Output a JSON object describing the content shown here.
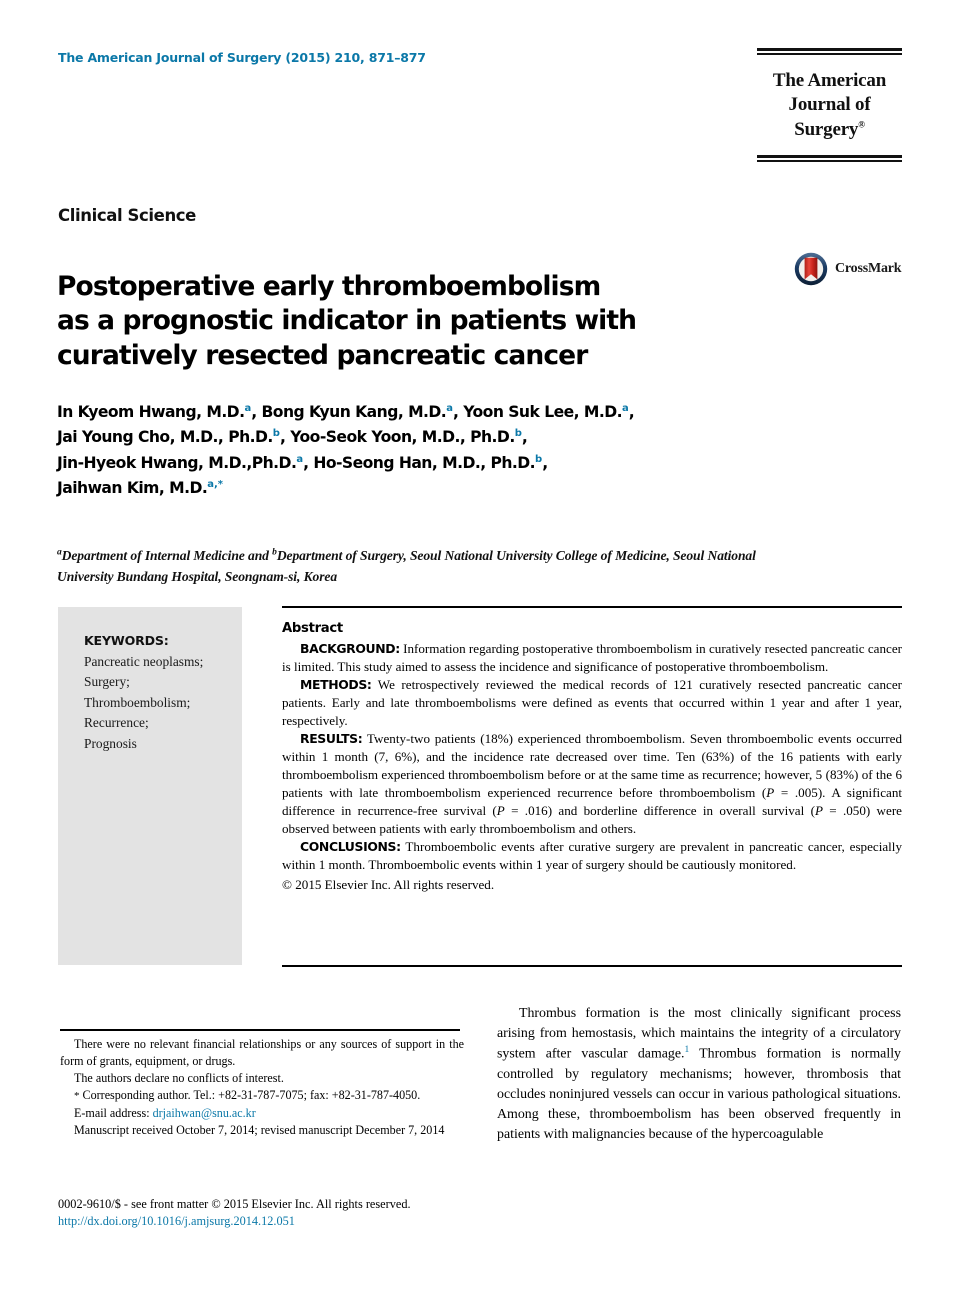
{
  "header": {
    "journal_citation": "The American Journal of Surgery (2015) 210, 871–877",
    "masthead_line1": "The American",
    "masthead_line2": "Journal of Surgery",
    "masthead_registered": "®",
    "accent_color": "#0b78a8"
  },
  "article": {
    "kicker": "Clinical Science",
    "title_line1": "Postoperative early thromboembolism",
    "title_line2": "as a prognostic indicator in patients with",
    "title_line3": "curatively resected pancreatic cancer",
    "crossmark_label": "CrossMark"
  },
  "authors": {
    "line1": "In Kyeom Hwang, M.D.",
    "line1_sup1": "a",
    "line1_b": ", Bong Kyun Kang, M.D.",
    "line1_sup2": "a",
    "line1_c": ", Yoon Suk Lee, M.D.",
    "line1_sup3": "a",
    "line1_d": ",",
    "line2": "Jai Young Cho, M.D., Ph.D.",
    "line2_sup1": "b",
    "line2_b": ", Yoo-Seok Yoon, M.D., Ph.D.",
    "line2_sup2": "b",
    "line2_c": ",",
    "line3": "Jin-Hyeok Hwang, M.D.,Ph.D.",
    "line3_sup1": "a",
    "line3_b": ", Ho-Seong Han, M.D., Ph.D.",
    "line3_sup2": "b",
    "line3_c": ",",
    "line4": "Jaihwan Kim, M.D.",
    "line4_sup1": "a",
    "line4_sup_sep": ",",
    "line4_sup2": "*"
  },
  "affiliations": {
    "sup_a": "a",
    "text_a": "Department of Internal Medicine and ",
    "sup_b": "b",
    "text_b": "Department of Surgery, Seoul National University College of Medicine, Seoul National University Bundang Hospital, Seongnam-si, Korea"
  },
  "keywords": {
    "heading": "KEYWORDS:",
    "items": [
      "Pancreatic neoplasms;",
      "Surgery;",
      "Thromboembolism;",
      "Recurrence;",
      "Prognosis"
    ],
    "background_color": "#e3e3e3"
  },
  "abstract": {
    "title": "Abstract",
    "background_label": "BACKGROUND:",
    "background_text": " Information regarding postoperative thromboembolism in curatively resected pancreatic cancer is limited. This study aimed to assess the incidence and significance of postoperative thromboembolism.",
    "methods_label": "METHODS:",
    "methods_text": "  We retrospectively reviewed the medical records of 121 curatively resected pancreatic cancer patients. Early and late thromboembolisms were defined as events that occurred within 1 year and after 1 year, respectively.",
    "results_label": "RESULTS:",
    "results_text_1": " Twenty-two patients (18%) experienced thromboembolism. Seven thromboembolic events occurred within 1 month (7, 6%), and the incidence rate decreased over time. Ten (63%) of the 16 patients with early thromboembolism experienced thromboembolism before or at the same time as recurrence; however, 5 (83%) of the 6 patients with late thromboembolism experienced recurrence before thromboembolism (",
    "results_p1": "P",
    "results_text_2": " = .005). A significant difference in recurrence-free survival (",
    "results_p2": "P",
    "results_text_3": " = .016) and borderline difference in overall survival (",
    "results_p3": "P",
    "results_text_4": " = .050) were observed between patients with early thromboembolism and others.",
    "conclusions_label": "CONCLUSIONS:",
    "conclusions_text": "  Thromboembolic events after curative surgery are prevalent in pancreatic cancer, especially within 1 month. Thromboembolic events within 1 year of surgery should be cautiously monitored.",
    "copyright": "© 2015 Elsevier Inc. All rights reserved."
  },
  "footnotes": {
    "funding": "There were no relevant financial relationships or any sources of support in the form of grants, equipment, or drugs.",
    "conflicts": "The authors declare no conflicts of interest.",
    "corresponding_marker": "*",
    "corresponding": " Corresponding author. Tel.: +82-31-787-7075; fax: +82-31-787-4050.",
    "email_label": "E-mail address: ",
    "email": "drjaihwan@snu.ac.kr",
    "manuscript_dates": "Manuscript received October 7, 2014; revised manuscript December 7, 2014"
  },
  "bottom": {
    "issn_line": "0002-9610/$ - see front matter © 2015 Elsevier Inc. All rights reserved.",
    "doi": "http://dx.doi.org/10.1016/j.amjsurg.2014.12.051"
  },
  "body": {
    "paragraph_1a": "Thrombus formation is the most clinically significant process arising from hemostasis, which maintains the integrity of a circulatory system after vascular damage.",
    "paragraph_1_ref": "1",
    "paragraph_1b": " Thrombus formation is normally controlled by regulatory mechanisms; however, thrombosis that occludes noninjured vessels can occur in various pathological situations. Among these, thromboembolism has been observed frequently in patients with malignancies because of the hypercoagulable"
  }
}
